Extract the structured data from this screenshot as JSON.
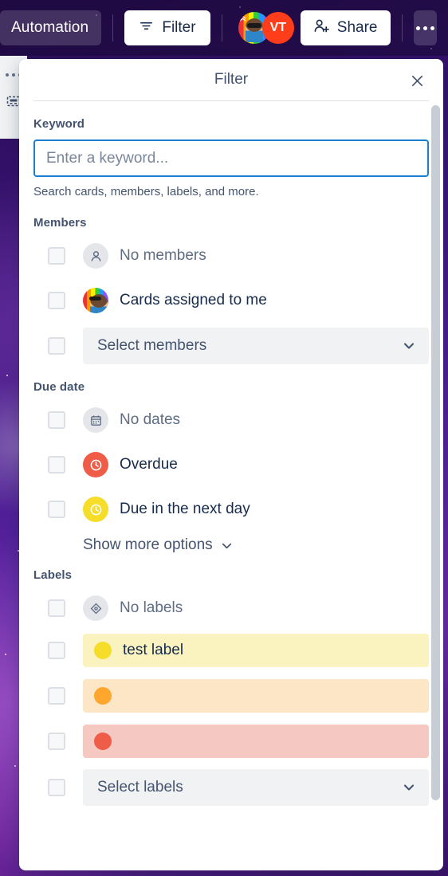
{
  "topbar": {
    "automation_label": "Automation",
    "filter_label": "Filter",
    "filter_icon": "funnel-icon",
    "share_label": "Share",
    "share_icon": "person-add-icon",
    "more_icon": "ellipsis-icon",
    "avatars": [
      {
        "name": "member-avatar-photo",
        "initials": ""
      },
      {
        "name": "member-avatar-vt",
        "initials": "VT",
        "color": "#FF3D1A"
      }
    ]
  },
  "left_rail": {
    "more_icon": "ellipsis-icon",
    "board_icon": "board-template-icon"
  },
  "panel": {
    "title": "Filter",
    "close_icon": "close-icon",
    "keyword": {
      "section_title": "Keyword",
      "placeholder": "Enter a keyword...",
      "value": "",
      "help": "Search cards, members, labels, and more."
    },
    "members": {
      "section_title": "Members",
      "options": [
        {
          "label": "No members",
          "icon": "person-icon",
          "checked": false
        },
        {
          "label": "Cards assigned to me",
          "icon": "avatar-photo",
          "checked": false
        }
      ],
      "select": {
        "label": "Select members",
        "chevron": "chevron-down-icon",
        "checked": false
      }
    },
    "due_date": {
      "section_title": "Due date",
      "options": [
        {
          "label": "No dates",
          "icon": "calendar-icon",
          "icon_style": "gray",
          "checked": false
        },
        {
          "label": "Overdue",
          "icon": "clock-icon",
          "icon_style": "red",
          "color": "#EF5C48",
          "checked": false
        },
        {
          "label": "Due in the next day",
          "icon": "clock-icon",
          "icon_style": "yellow",
          "color": "#F5DD29",
          "checked": false
        }
      ],
      "show_more_label": "Show more options",
      "show_more_icon": "chevron-down-icon"
    },
    "labels": {
      "section_title": "Labels",
      "no_labels": {
        "label": "No labels",
        "icon": "tag-icon",
        "checked": false
      },
      "items": [
        {
          "label": "test label",
          "swatch": "#F5DD29",
          "background": "#FAF3C0",
          "checked": false
        },
        {
          "label": "",
          "swatch": "#FFA62E",
          "background": "#FCE6C6",
          "checked": false
        },
        {
          "label": "",
          "swatch": "#EF5C48",
          "background": "#F5C8C2",
          "checked": false
        }
      ],
      "select": {
        "label": "Select labels",
        "chevron": "chevron-down-icon",
        "checked": false
      }
    }
  },
  "colors": {
    "accent_blue": "#1C7ED0",
    "text_dark": "#172B4D",
    "text_muted": "#44546F",
    "panel_bg": "#FFFFFF",
    "board_purple": "#55219C"
  }
}
